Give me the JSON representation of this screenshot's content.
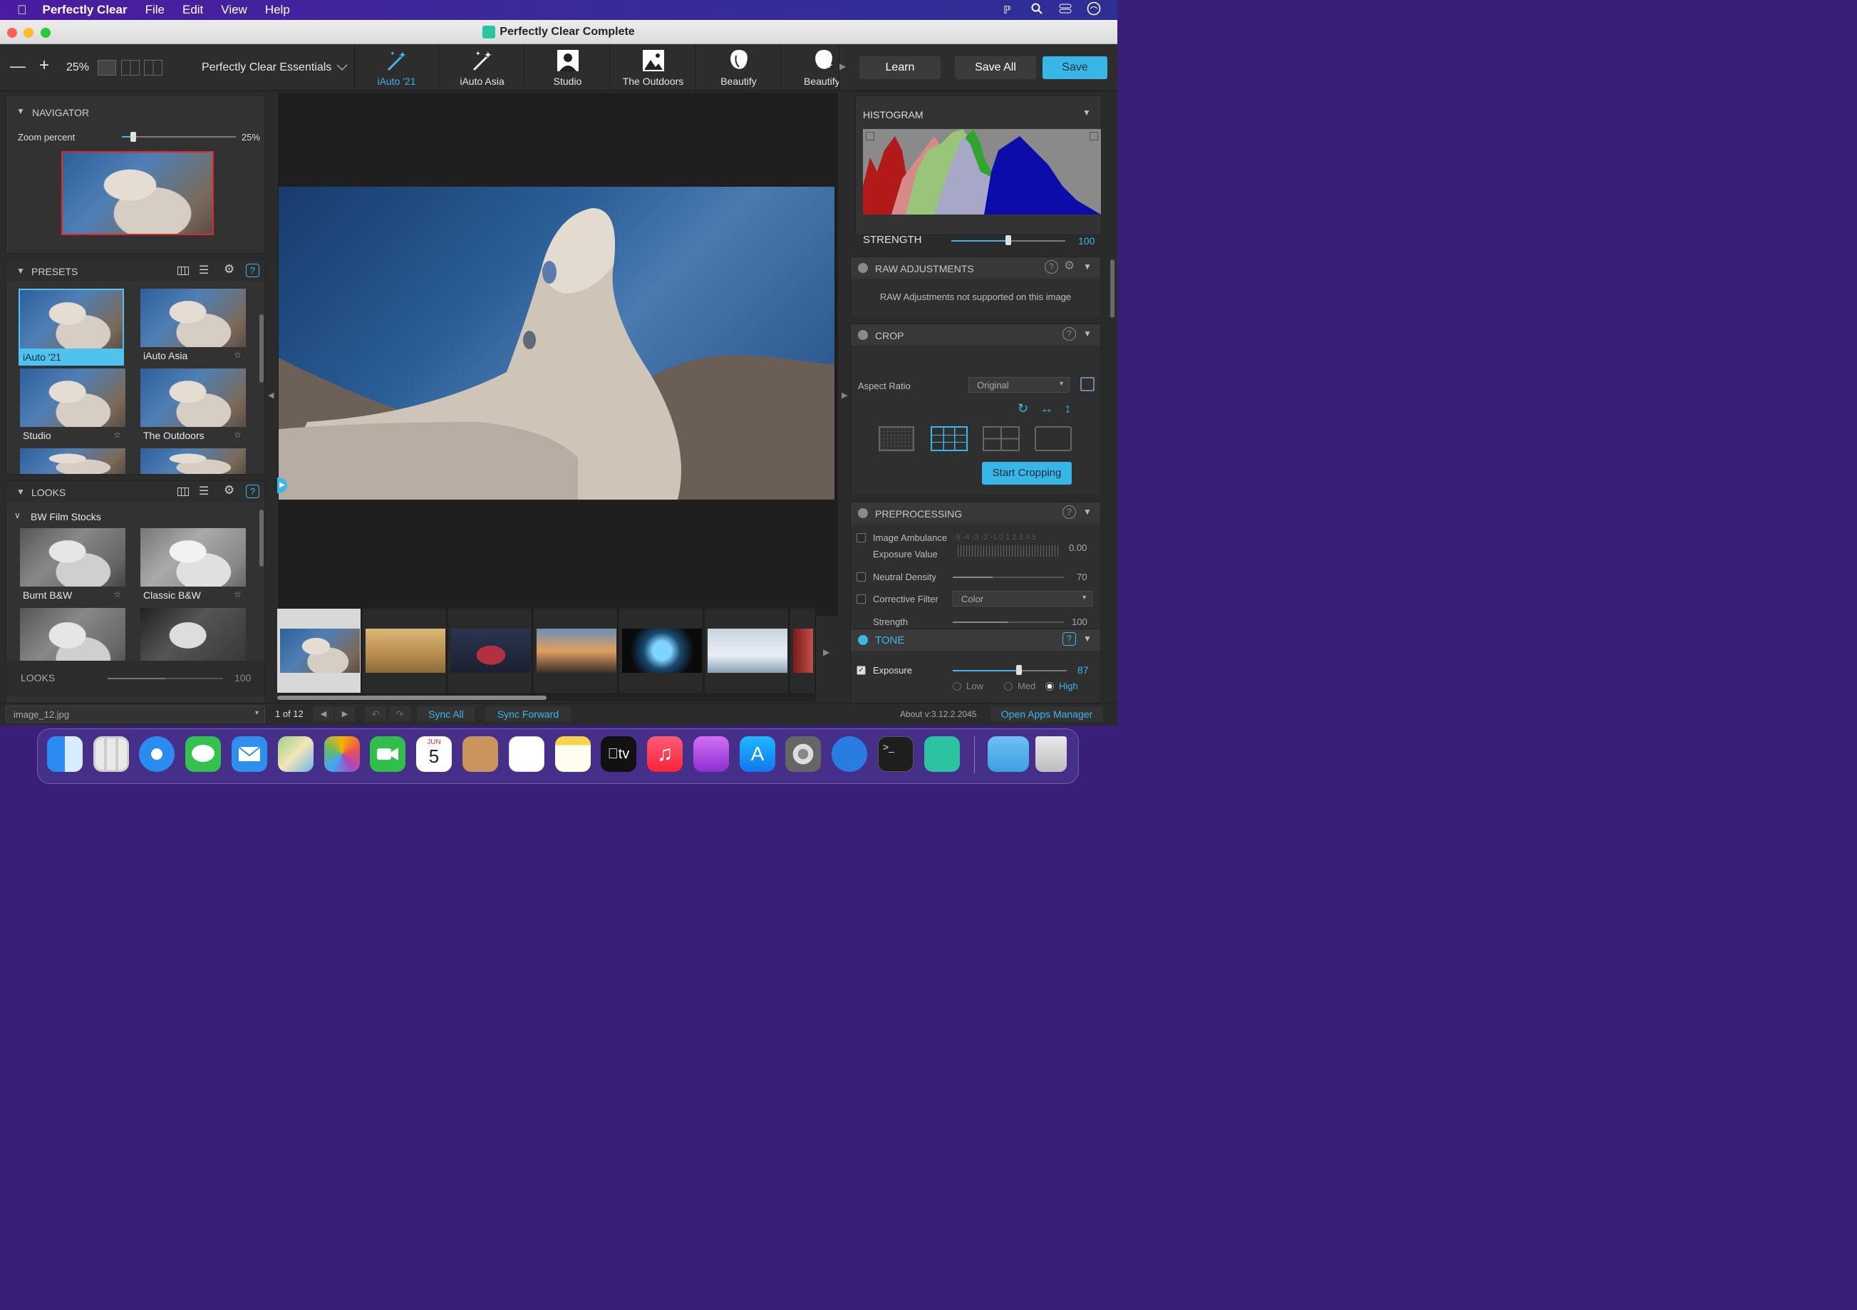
{
  "menubar": {
    "app": "Perfectly Clear",
    "items": [
      "File",
      "Edit",
      "View",
      "Help"
    ]
  },
  "window": {
    "title": "Perfectly Clear Complete"
  },
  "toolbar": {
    "zoom": "25%",
    "preset_group": "Perfectly Clear Essentials",
    "tabs": [
      "iAuto '21",
      "iAuto Asia",
      "Studio",
      "The Outdoors",
      "Beautify",
      "Beautify"
    ],
    "learn": "Learn",
    "save_all": "Save All",
    "save": "Save"
  },
  "navigator": {
    "title": "NAVIGATOR",
    "zoom_label": "Zoom percent",
    "zoom_value": "25%",
    "zoom_fraction": 0.1
  },
  "presets": {
    "title": "PRESETS",
    "items": [
      "iAuto '21",
      "iAuto Asia",
      "Studio",
      "The Outdoors"
    ]
  },
  "looks": {
    "title": "LOOKS",
    "group": "BW Film Stocks",
    "items": [
      "Burnt B&W",
      "Classic B&W"
    ],
    "footer_label": "LOOKS",
    "footer_value": "100",
    "footer_fraction": 0.5
  },
  "histogram": {
    "title": "HISTOGRAM"
  },
  "strength": {
    "label": "STRENGTH",
    "value": "100",
    "fraction": 0.5
  },
  "raw": {
    "title": "RAW ADJUSTMENTS",
    "message": "RAW Adjustments not supported on this image"
  },
  "crop": {
    "title": "CROP",
    "aspect_label": "Aspect Ratio",
    "aspect_value": "Original",
    "start": "Start Cropping"
  },
  "preprocessing": {
    "title": "PREPROCESSING",
    "ambulance": "Image Ambulance",
    "exposure_value_label": "Exposure Value",
    "scale": "-5 -4 -3 -2 -1 0 1 2 3 4 5",
    "ev": "0.00",
    "neutral_density": "Neutral Density",
    "nd_value": "70",
    "nd_fraction": 0.36,
    "corrective": "Corrective Filter",
    "corrective_value": "Color",
    "strength": "Strength",
    "strength_value": "100",
    "strength_fraction": 0.5
  },
  "tone": {
    "title": "TONE",
    "exposure": "Exposure",
    "exposure_value": "87",
    "exposure_fraction": 0.58,
    "options": [
      "Low",
      "Med",
      "High"
    ]
  },
  "status": {
    "filename": "image_12.jpg",
    "count": "1 of 12",
    "sync_all": "Sync All",
    "sync_forward": "Sync Forward",
    "about": "About v:3.12.2.2045",
    "open_apps": "Open Apps Manager"
  },
  "dock": {
    "calendar_month": "JUN",
    "calendar_day": "5",
    "tv": "tv"
  },
  "colors": {
    "accent": "#3bb7ea",
    "save": "#38b6e8",
    "selected_preset": "#4fc3f0"
  }
}
